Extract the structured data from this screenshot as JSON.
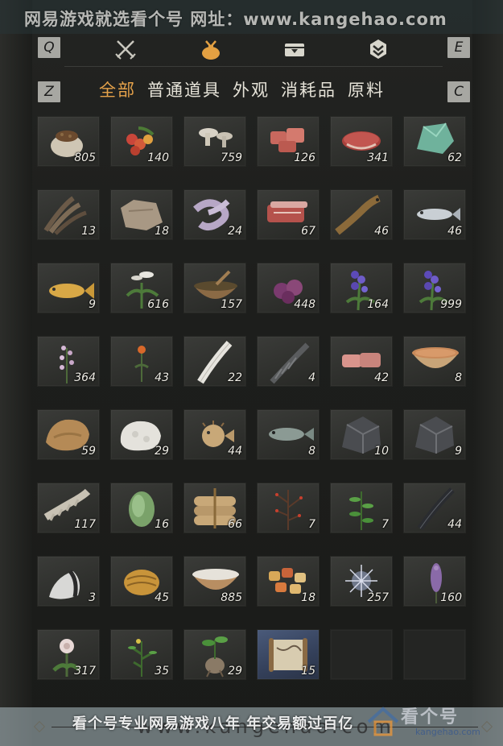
{
  "watermark": {
    "top": "网易游戏就选看个号  网址：www.kangehao.com",
    "bottom_text": "看个号专业网易游戏八年 年交易额过百亿",
    "bottom_url": "www.kangehao.com",
    "logo_main": "看个号",
    "logo_sub": "kangehao.com"
  },
  "keys": {
    "prev_tab": "Q",
    "next_tab": "E",
    "prev_sub": "Z",
    "next_sub": "C"
  },
  "tabs": [
    {
      "icon": "crossed-swords-icon",
      "active": false
    },
    {
      "icon": "pouch-icon",
      "active": true
    },
    {
      "icon": "chest-icon",
      "active": false
    },
    {
      "icon": "gem-icon",
      "active": false
    }
  ],
  "subcategories": [
    "全部",
    "普通道具",
    "外观",
    "消耗品",
    "原料"
  ],
  "active_subcategory": "全部",
  "items": [
    {
      "icon": "grain-sack-icon",
      "count": "805"
    },
    {
      "icon": "red-berries-icon",
      "count": "140"
    },
    {
      "icon": "mushrooms-icon",
      "count": "759"
    },
    {
      "icon": "raw-meat-chunks-icon",
      "count": "126"
    },
    {
      "icon": "beef-steak-icon",
      "count": "341"
    },
    {
      "icon": "jade-stone-icon",
      "count": "62"
    },
    {
      "icon": "feathers-icon",
      "count": "13"
    },
    {
      "icon": "animal-hide-icon",
      "count": "18"
    },
    {
      "icon": "intestines-icon",
      "count": "24"
    },
    {
      "icon": "meat-slab-icon",
      "count": "67"
    },
    {
      "icon": "eel-fish-icon",
      "count": "46"
    },
    {
      "icon": "silver-fish-icon",
      "count": "46"
    },
    {
      "icon": "golden-carp-icon",
      "count": "9"
    },
    {
      "icon": "white-orchid-icon",
      "count": "616"
    },
    {
      "icon": "herb-bowl-icon",
      "count": "157"
    },
    {
      "icon": "purple-petals-icon",
      "count": "448"
    },
    {
      "icon": "purple-flower-icon",
      "count": "164"
    },
    {
      "icon": "purple-flower-icon",
      "count": "999"
    },
    {
      "icon": "lilac-sprig-icon",
      "count": "364"
    },
    {
      "icon": "orange-flower-icon",
      "count": "43"
    },
    {
      "icon": "white-feather-icon",
      "count": "22"
    },
    {
      "icon": "dark-feather-icon",
      "count": "4"
    },
    {
      "icon": "pink-meat-icon",
      "count": "42"
    },
    {
      "icon": "soup-bowl-icon",
      "count": "8"
    },
    {
      "icon": "fur-pelt-icon",
      "count": "59"
    },
    {
      "icon": "white-fleece-icon",
      "count": "29"
    },
    {
      "icon": "pufferfish-icon",
      "count": "44"
    },
    {
      "icon": "grey-fish-icon",
      "count": "8"
    },
    {
      "icon": "dark-ore-icon",
      "count": "10"
    },
    {
      "icon": "dark-ore-icon",
      "count": "9"
    },
    {
      "icon": "spine-bone-icon",
      "count": "117"
    },
    {
      "icon": "melon-icon",
      "count": "16"
    },
    {
      "icon": "tied-bundle-icon",
      "count": "66"
    },
    {
      "icon": "red-berry-branch-icon",
      "count": "7"
    },
    {
      "icon": "green-herb-icon",
      "count": "7"
    },
    {
      "icon": "black-feather-icon",
      "count": "44"
    },
    {
      "icon": "fluffy-tuft-icon",
      "count": "3"
    },
    {
      "icon": "golden-cocoon-icon",
      "count": "45"
    },
    {
      "icon": "milk-bowl-icon",
      "count": "885"
    },
    {
      "icon": "candied-fruit-icon",
      "count": "18"
    },
    {
      "icon": "sparkle-dust-icon",
      "count": "257"
    },
    {
      "icon": "lavender-spike-icon",
      "count": "160"
    },
    {
      "icon": "white-flower-icon",
      "count": "317"
    },
    {
      "icon": "yellow-flower-plant-icon",
      "count": "35"
    },
    {
      "icon": "root-plant-icon",
      "count": "29"
    },
    {
      "icon": "scroll-map-icon",
      "count": "15",
      "rare": true
    },
    {
      "icon": "",
      "count": "",
      "empty": true
    },
    {
      "icon": "",
      "count": "",
      "empty": true
    }
  ]
}
